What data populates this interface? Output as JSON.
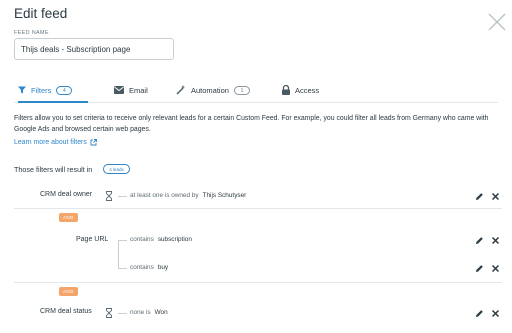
{
  "header": {
    "title": "Edit feed"
  },
  "feed_name": {
    "label": "FEED NAME",
    "value": "Thijs deals - Subscription page"
  },
  "tabs": [
    {
      "label": "Filters",
      "count": "4",
      "icon": "filter-icon",
      "active": true
    },
    {
      "label": "Email",
      "icon": "envelope-icon"
    },
    {
      "label": "Automation",
      "count": "1",
      "icon": "magic-wand-icon"
    },
    {
      "label": "Access",
      "icon": "lock-icon"
    }
  ],
  "description": "Filters allow you to set criteria to receive only relevant leads for a certain Custom Feed. For example, you could filter all leads from Germany who came with Google Ads and browsed certain web pages.",
  "learn_more": "Learn more about filters",
  "results": {
    "label": "Those filters will result in",
    "badge": "4 leads"
  },
  "filters": [
    {
      "label": "CRM deal owner",
      "operator": "at least one is owned by",
      "value": "Thijs Schutyser"
    },
    {
      "connector": "AND"
    },
    {
      "label": "Page URL",
      "conditions": [
        {
          "operator": "contains",
          "value": "subscription"
        },
        {
          "operator": "contains",
          "value": "buy"
        }
      ]
    },
    {
      "connector": "AND"
    },
    {
      "label": "CRM deal status",
      "operator": "none is",
      "value": "Won"
    }
  ],
  "colors": {
    "accent": "#2f86c9",
    "and_badge": "#f3a56a",
    "text": "#2b3a42"
  }
}
